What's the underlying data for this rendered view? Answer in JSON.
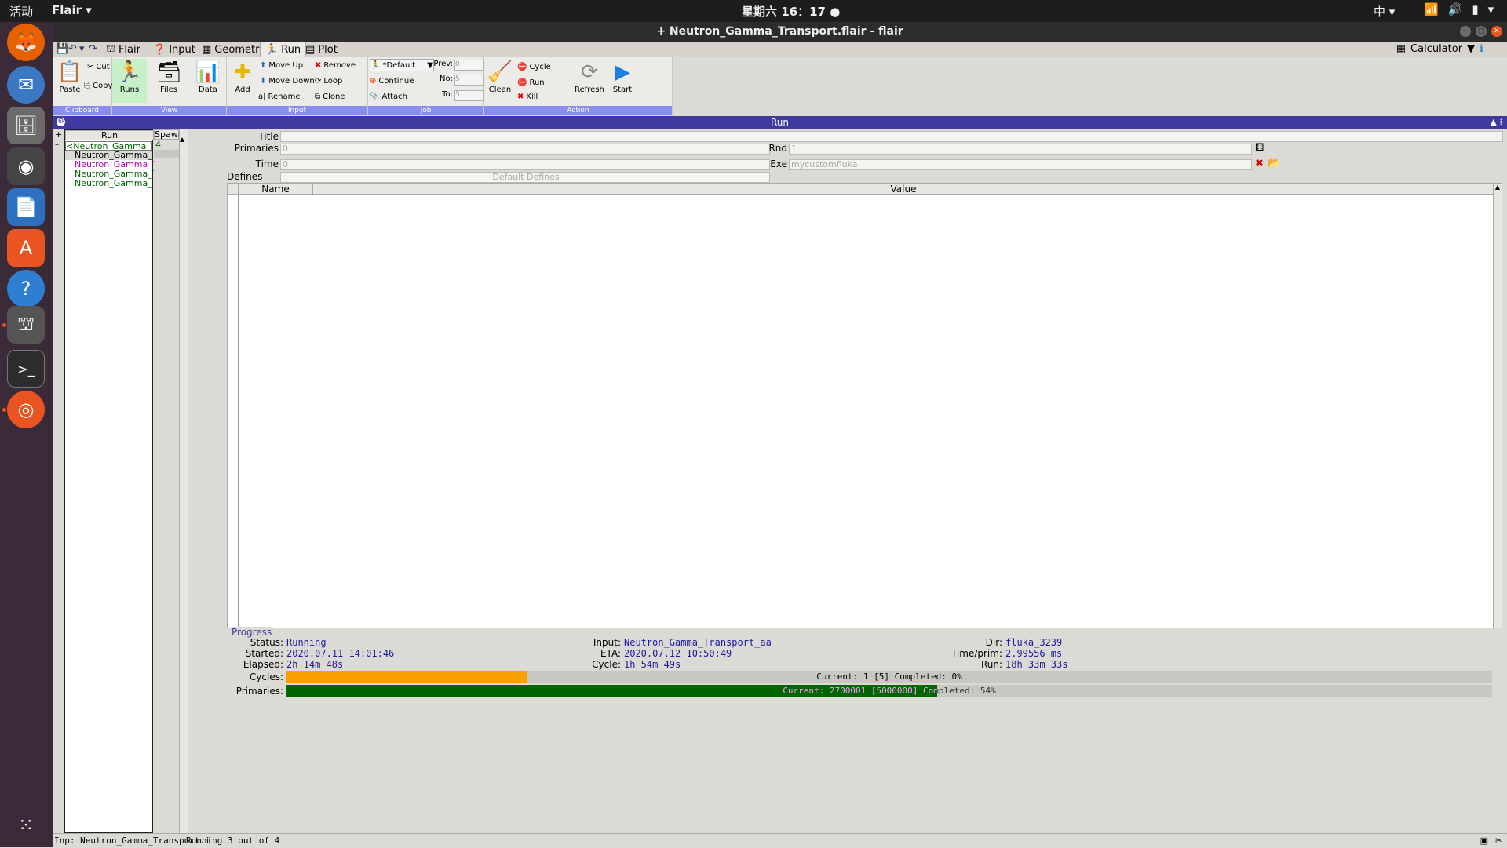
{
  "topbar": {
    "activities": "活动",
    "app_menu": "Flair ▾",
    "clock": "星期六 16：17 ●",
    "ime": "中 ▾"
  },
  "window": {
    "title": "+ Neutron_Gamma_Transport.flair - flair"
  },
  "tabs": [
    {
      "label": "Flair"
    },
    {
      "label": "Input"
    },
    {
      "label": "Geometry"
    },
    {
      "label": "Run"
    },
    {
      "label": "Plot"
    }
  ],
  "calculator": {
    "label": "Calculator"
  },
  "ribbon": {
    "clipboard": {
      "label": "Clipboard",
      "paste": "Paste",
      "cut": "Cut",
      "copy": "Copy"
    },
    "view": {
      "label": "View",
      "runs": "Runs",
      "files": "Files",
      "data": "Data"
    },
    "input": {
      "label": "Input",
      "add": "Add",
      "move_up": "Move Up",
      "move_down": "Move Down",
      "rename": "Rename",
      "remove": "Remove",
      "loop": "Loop",
      "clone": "Clone"
    },
    "job": {
      "label": "Job",
      "queue": "*Default",
      "continue": "Continue",
      "attach": "Attach",
      "prev": "Prev:",
      "no": "No:",
      "to": "To:",
      "prev_val": "0",
      "no_val": "5",
      "to_val": "5"
    },
    "action": {
      "label": "Action",
      "cycle": "Cycle",
      "run": "Run",
      "kill": "Kill",
      "clean": "Clean",
      "refresh": "Refresh",
      "start": "Start"
    }
  },
  "panel": {
    "title": "Run"
  },
  "runlist": {
    "col_run": "Run",
    "col_spawn": "Spawn",
    "items": [
      {
        "name": "<Neutron_Gamma_Trans",
        "spawn": "4",
        "color": "#006000"
      },
      {
        "name": "Neutron_Gamma_Tran",
        "spawn": "",
        "color": "#000000"
      },
      {
        "name": "Neutron_Gamma_Tran",
        "spawn": "",
        "color": "#b000b0"
      },
      {
        "name": "Neutron_Gamma_Tran",
        "spawn": "",
        "color": "#006000"
      },
      {
        "name": "Neutron_Gamma_Tran",
        "spawn": "",
        "color": "#006000"
      }
    ]
  },
  "form": {
    "title_label": "Title",
    "primaries_label": "Primaries",
    "primaries_value": "0",
    "rnd_label": "Rnd",
    "rnd_value": "1",
    "time_label": "Time",
    "time_value": "0",
    "exe_label": "Exe",
    "exe_value": "mycustomfluka",
    "defines_label": "Defines",
    "defines_button": "Default Defines"
  },
  "defines_table": {
    "col_name": "Name",
    "col_value": "Value"
  },
  "progress": {
    "legend": "Progress",
    "status_label": "Status:",
    "status_value": "Running",
    "started_label": "Started:",
    "started_value": "2020.07.11 14:01:46",
    "elapsed_label": "Elapsed:",
    "elapsed_value": "2h 14m 48s",
    "input_label": "Input:",
    "input_value": "Neutron_Gamma_Transport_aa",
    "eta_label": "ETA:",
    "eta_value": "2020.07.12 10:50:49",
    "cycle_label": "Cycle:",
    "cycle_value": "1h 54m 49s",
    "dir_label": "Dir:",
    "dir_value": "fluka_3239",
    "timeprim_label": "Time/prim:",
    "timeprim_value": "2.99556 ms",
    "run_label": "Run:",
    "run_value": "18h 33m 33s",
    "cycles_label": "Cycles:",
    "cycles_text": "Current: 1 [5]  Completed: 0%",
    "cycles_fraction": 0.2,
    "primaries_label": "Primaries:",
    "primaries_text": "Current: 2700001 [5000000]  Completed: 54%",
    "primaries_fraction": 0.54
  },
  "statusbar": {
    "left": "Inp: Neutron_Gamma_Transport.i",
    "right": "Running 3 out of 4"
  },
  "colors": {
    "accent": "#3e3aa0",
    "cycles_bar": "#f8a000",
    "primaries_bar": "#006600",
    "value_text": "#1a1aa0"
  }
}
